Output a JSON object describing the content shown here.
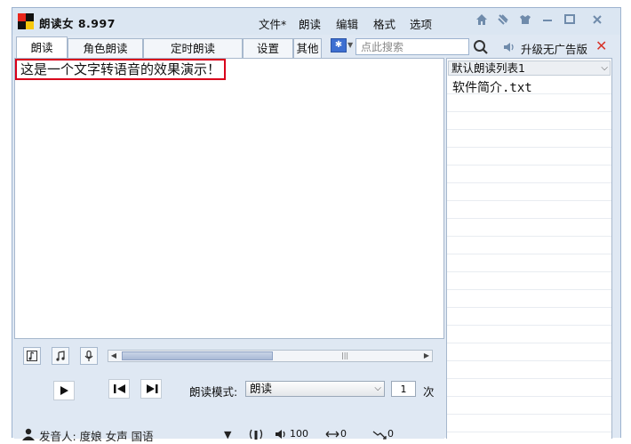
{
  "app": {
    "title": "朗读女 8.997"
  },
  "menu": {
    "items": [
      "文件*",
      "朗读",
      "编辑",
      "格式",
      "选项"
    ]
  },
  "tabs": [
    "朗读",
    "角色朗读",
    "定时朗读",
    "设置",
    "其他"
  ],
  "search": {
    "placeholder": "点此搜索"
  },
  "upgrade": {
    "label": "升级无广告版"
  },
  "editor": {
    "text": "这是一个文字转语音的效果演示！"
  },
  "playlist": {
    "name": "默认朗读列表1",
    "items": [
      "软件简介.txt"
    ]
  },
  "player": {
    "mode_label": "朗读模式:",
    "mode_value": "朗读",
    "count": "1",
    "count_unit": "次"
  },
  "voice": {
    "label": "发音人: 度娘 女声 国语",
    "volume": "100",
    "rate": "0",
    "pitch": "0"
  },
  "colors": {
    "highlight_border": "#d9001b",
    "accent": "#3d6fd1",
    "close": "#d8342a"
  }
}
